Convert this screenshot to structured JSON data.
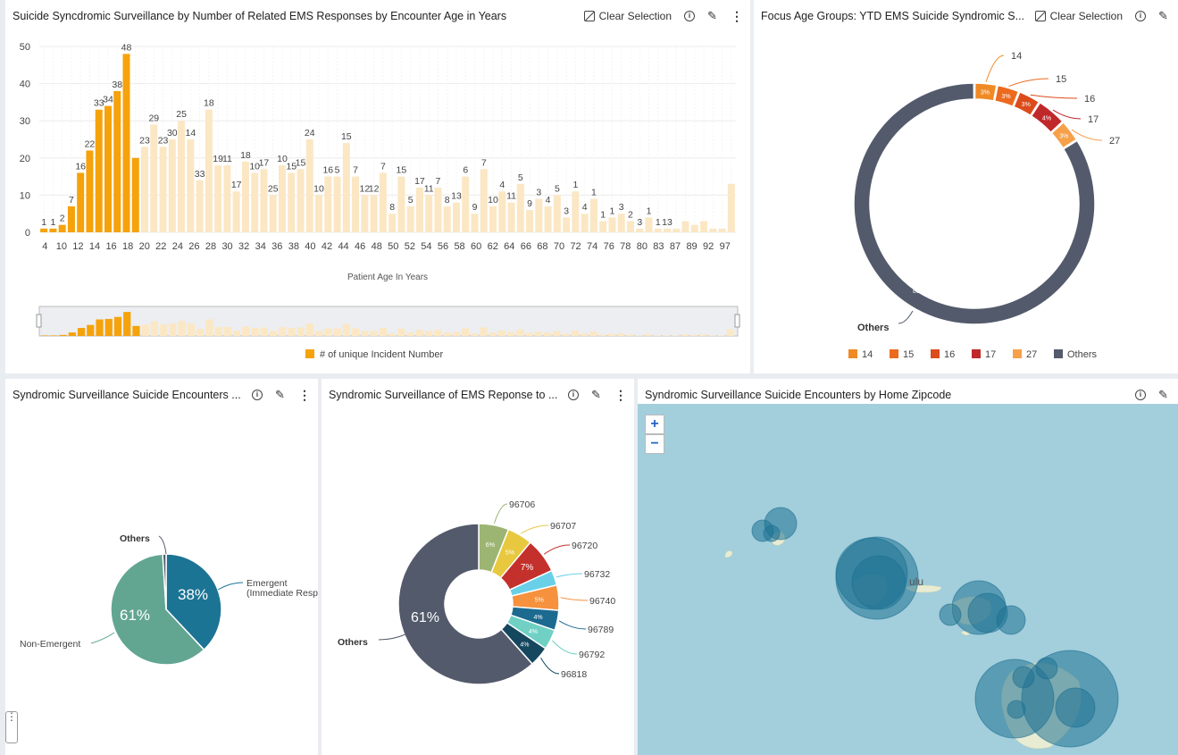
{
  "panels": {
    "age_chart": {
      "title": "Suicide Syncdromic Surveillance by Number of Related EMS Responses by Encounter Age in Years",
      "clear_label": "Clear Selection"
    },
    "focus_donut": {
      "title": "Focus Age Groups: YTD EMS Suicide Syndromic S...",
      "clear_label": "Clear Selection"
    },
    "acuity_pie": {
      "title": "Syndromic Surveillance Suicide Encounters ..."
    },
    "zip_donut": {
      "title": "Syndromic Surveillance of EMS Reponse to ..."
    },
    "map": {
      "title": "Syndromic Surveillance Suicide Encounters by Home Zipcode",
      "zoom_in": "+",
      "zoom_out": "−",
      "place_label": "ulu"
    }
  },
  "colors": {
    "highlight_bar": "#f5a20b",
    "faded_bar": "#fbe7c4",
    "dark_slate": "#535a6b",
    "teal": "#1c7494",
    "sage": "#62a692",
    "map_water": "#a3cedc"
  },
  "chart_data": [
    {
      "type": "bar",
      "xlabel": "Patient Age In Years",
      "ylabel": "",
      "ylim": [
        0,
        50
      ],
      "yticks": [
        0,
        10,
        20,
        30,
        40,
        50
      ],
      "legend": "# of unique Incident Number",
      "legend_placement": "bottom",
      "grid": true,
      "highlighted_through_index": 10,
      "x": [
        "4",
        "9",
        "10",
        "11",
        "12",
        "13",
        "14",
        "15",
        "16",
        "17",
        "18",
        "19",
        "20",
        "21",
        "22",
        "23",
        "24",
        "25",
        "26",
        "27",
        "28",
        "29",
        "30",
        "31",
        "32",
        "33",
        "34",
        "35",
        "36",
        "37",
        "38",
        "39",
        "40",
        "41",
        "42",
        "43",
        "44",
        "45",
        "46",
        "47",
        "48",
        "49",
        "50",
        "51",
        "52",
        "53",
        "54",
        "55",
        "56",
        "57",
        "58",
        "59",
        "60",
        "61",
        "62",
        "63",
        "64",
        "65",
        "66",
        "67",
        "68",
        "69",
        "70",
        "71",
        "72",
        "73",
        "74",
        "75",
        "76",
        "77",
        "78",
        "79",
        "80",
        "81",
        "83",
        "85",
        "87",
        "88",
        "89",
        "90",
        "92",
        "95",
        "97"
      ],
      "values": [
        1,
        1,
        2,
        7,
        16,
        22,
        33,
        34,
        38,
        48,
        20,
        23,
        29,
        23,
        25,
        30,
        25,
        14,
        33,
        18,
        18,
        11,
        19,
        16,
        17,
        10,
        18,
        16,
        17,
        25,
        10,
        15,
        15,
        24,
        15,
        10,
        10,
        16,
        5,
        15,
        7,
        12,
        10,
        12,
        7,
        8,
        15,
        5,
        17,
        7,
        11,
        8,
        13,
        6,
        9,
        7,
        10,
        4,
        11,
        5,
        9,
        3,
        4,
        5,
        3,
        1,
        4,
        1,
        1,
        1,
        3,
        2,
        3,
        1,
        1,
        13
      ],
      "data_labels": [
        "1",
        "1",
        "2",
        "7",
        "16",
        "22",
        "33",
        "34",
        "38",
        "48",
        "23",
        "29",
        "23",
        "30",
        "25",
        "14",
        "33",
        "18",
        "19",
        "11",
        "17",
        "18",
        "10",
        "17",
        "25",
        "10",
        "15",
        "15",
        "24",
        "10",
        "16",
        "5",
        "15",
        "7",
        "12",
        "12",
        "7",
        "8",
        "15",
        "5",
        "17",
        "11",
        "7",
        "8",
        "13",
        "6",
        "9",
        "7",
        "10",
        "4",
        "11",
        "5",
        "9",
        "3",
        "4",
        "5",
        "3",
        "1",
        "4",
        "1",
        "1",
        "1",
        "3",
        "2",
        "3",
        "1",
        "1",
        "13"
      ],
      "xtick_labels": [
        "4",
        "10",
        "12",
        "14",
        "16",
        "18",
        "20",
        "22",
        "24",
        "26",
        "28",
        "30",
        "32",
        "34",
        "36",
        "38",
        "40",
        "42",
        "44",
        "46",
        "48",
        "50",
        "52",
        "54",
        "56",
        "58",
        "60",
        "62",
        "64",
        "66",
        "68",
        "70",
        "72",
        "74",
        "76",
        "78",
        "80",
        "83",
        "87",
        "89",
        "92",
        "97"
      ]
    },
    {
      "type": "pie",
      "variant": "donut",
      "categories": [
        "14",
        "15",
        "16",
        "17",
        "27",
        "Others"
      ],
      "values": [
        3,
        3,
        3,
        4,
        3,
        83
      ],
      "slice_labels": [
        "3%",
        "3%",
        "3%",
        "4%",
        "3%",
        "83%"
      ],
      "colors": [
        "#f08a24",
        "#ec6a1e",
        "#dc4b1c",
        "#c0282a",
        "#f6a04a",
        "#535a6b"
      ],
      "legend_placement": "bottom"
    },
    {
      "type": "pie",
      "categories": [
        "Emergent (Immediate Response)...",
        "Non-Emergent",
        "Others"
      ],
      "values": [
        38,
        61,
        1
      ],
      "slice_labels": [
        "38%",
        "61%",
        ""
      ],
      "colors": [
        "#1c7494",
        "#62a692",
        "#535a6b"
      ]
    },
    {
      "type": "pie",
      "variant": "donut",
      "categories": [
        "96706",
        "96707",
        "96720",
        "96732",
        "96740",
        "96789",
        "96792",
        "96818",
        "Others"
      ],
      "values": [
        6,
        5,
        7,
        3,
        5,
        4,
        4,
        4,
        61
      ],
      "slice_labels": [
        "6%",
        "5%",
        "7%",
        "",
        "5%",
        "4%",
        "4%",
        "4%",
        "61%"
      ],
      "colors": [
        "#9db572",
        "#e8c83e",
        "#c4302b",
        "#6ad0e8",
        "#f6913d",
        "#1c6a90",
        "#6fd0c3",
        "#15475f",
        "#535a6b"
      ]
    }
  ]
}
